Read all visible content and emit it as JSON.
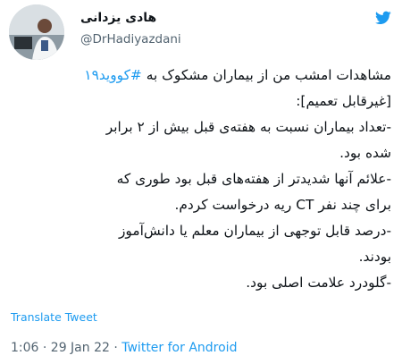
{
  "user": {
    "display_name": "هادی یزدانی",
    "handle": "@DrHadiyazdani",
    "avatar_icon": "profile-photo",
    "platform_icon": "twitter-bird-icon"
  },
  "tweet": {
    "line1_prefix": "مشاهدات امشب من از بیماران مشکوک به",
    "hashtag": "#کووید۱۹",
    "line2": "[غیرقابل تعمیم]:",
    "line3": "-تعداد بیماران نسبت به هفته‌ی قبل بیش از ۲ برابر",
    "line4": "شده بود.",
    "line5": "-علائم آنها شدیدتر از هفته‌های قبل بود طوری که",
    "line6": "برای چند نفر CT ریه درخواست کردم.",
    "line7": "-درصد قابل توجهی از بیماران معلم یا دانش‌آموز",
    "line8": "بودند.",
    "line9": "-گلودرد علامت اصلی بود."
  },
  "translate_label": "Translate Tweet",
  "meta": {
    "time_date": "1:06 · 29 Jan 22 · ",
    "source": "Twitter for Android"
  },
  "colors": {
    "accent": "#1d9bf0",
    "text": "#0f1419",
    "secondary": "#536471"
  }
}
